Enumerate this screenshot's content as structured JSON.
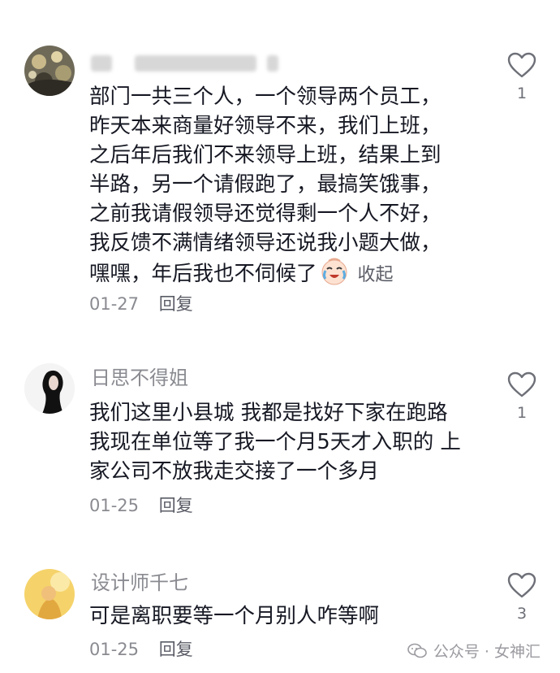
{
  "comments": [
    {
      "username": "",
      "lines": [
        "部门一共三个人，一个领导两个员工，",
        "昨天本来商量好领导不来，我们上班，",
        "之后年后我们不来领导上班，结果上到",
        "半路，另一个请假跑了，最搞笑饿事，",
        "之前我请假领导还觉得剩一个人不好，",
        "我反馈不满情绪领导还说我小题大做，",
        "嘿嘿，年后我也不伺候了"
      ],
      "collapse_label": "收起",
      "date": "01-27",
      "reply_label": "回复",
      "likes": "1"
    },
    {
      "username": "日思不得姐",
      "lines": [
        "我们这里小县城 我都是找好下家在跑路",
        "我现在单位等了我一个月5天才入职的 上",
        "家公司不放我走交接了一个多月"
      ],
      "date": "01-25",
      "reply_label": "回复",
      "likes": "1"
    },
    {
      "username": "设计师千七",
      "lines": [
        "可是离职要等一个月别人咋等啊"
      ],
      "date": "01-25",
      "reply_label": "回复",
      "likes": "3"
    }
  ],
  "watermark": "公众号 · 女神汇",
  "icons": {
    "like": "heart-outline-icon",
    "emoji": "crying-laughing-emoji-icon",
    "watermark": "wechat-icon"
  }
}
